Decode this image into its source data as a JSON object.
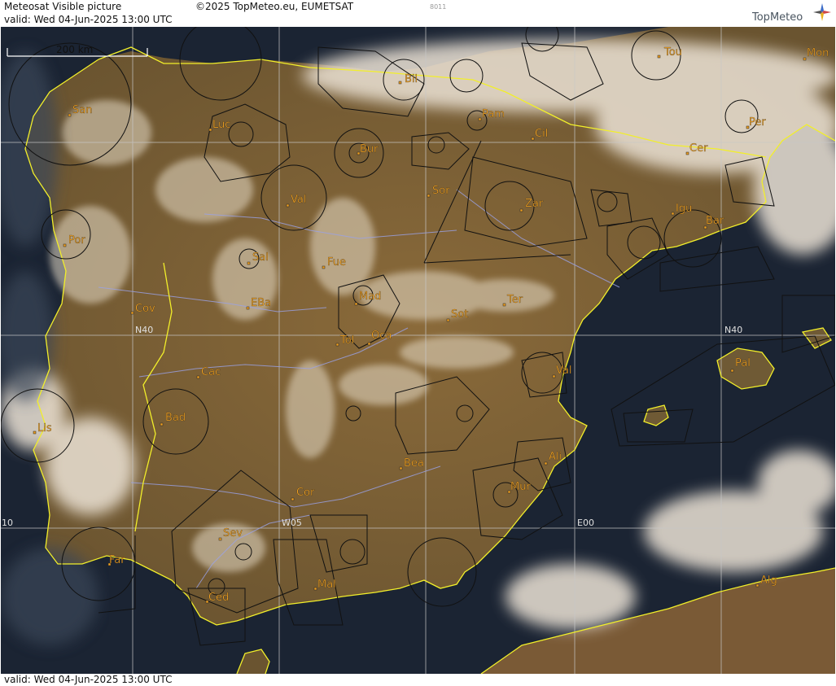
{
  "header": {
    "title": "Meteosat Visible picture",
    "copyright": "©2025 TopMeteo.eu, EUMETSAT",
    "code": "8011",
    "valid": "valid:  Wed  04-Jun-2025  13:00 UTC",
    "logo_text": "TopMeteo"
  },
  "footer": {
    "valid": "valid:  Wed  04-Jun-2025  13:00 UTC"
  },
  "scale": {
    "label": "200 km"
  },
  "grid_labels": {
    "n40_west": "N40",
    "n40_east": "N40",
    "w05": "W05",
    "e00": "E00",
    "w10": "10"
  },
  "cities": [
    {
      "name": "San"
    },
    {
      "name": "Luc"
    },
    {
      "name": "Bur"
    },
    {
      "name": "Bil"
    },
    {
      "name": "Pam"
    },
    {
      "name": "Tou"
    },
    {
      "name": "Mon"
    },
    {
      "name": "Cil"
    },
    {
      "name": "Per"
    },
    {
      "name": "Cer"
    },
    {
      "name": "Val"
    },
    {
      "name": "Sor"
    },
    {
      "name": "Zar"
    },
    {
      "name": "Igu"
    },
    {
      "name": "Bar"
    },
    {
      "name": "Por"
    },
    {
      "name": "Sal"
    },
    {
      "name": "Fue"
    },
    {
      "name": "Mad"
    },
    {
      "name": "Cov"
    },
    {
      "name": "EBa"
    },
    {
      "name": "Sot"
    },
    {
      "name": "Ter"
    },
    {
      "name": "Tol"
    },
    {
      "name": "Oca"
    },
    {
      "name": "Cac"
    },
    {
      "name": "Val"
    },
    {
      "name": "Pal"
    },
    {
      "name": "Bad"
    },
    {
      "name": "Lis"
    },
    {
      "name": "Ali"
    },
    {
      "name": "Bea"
    },
    {
      "name": "Mur"
    },
    {
      "name": "Cor"
    },
    {
      "name": "Sev"
    },
    {
      "name": "Far"
    },
    {
      "name": "Mal"
    },
    {
      "name": "Ced"
    },
    {
      "name": "Alg"
    }
  ],
  "colors": {
    "sea": "#1b2433",
    "land": "#7a6238",
    "cloud": "#e8ddd0",
    "coast": "#f2ef2a",
    "city": "#f0a020",
    "grid": "#c8c8c8",
    "airspace": "#111111",
    "river": "#9aa2e8"
  }
}
